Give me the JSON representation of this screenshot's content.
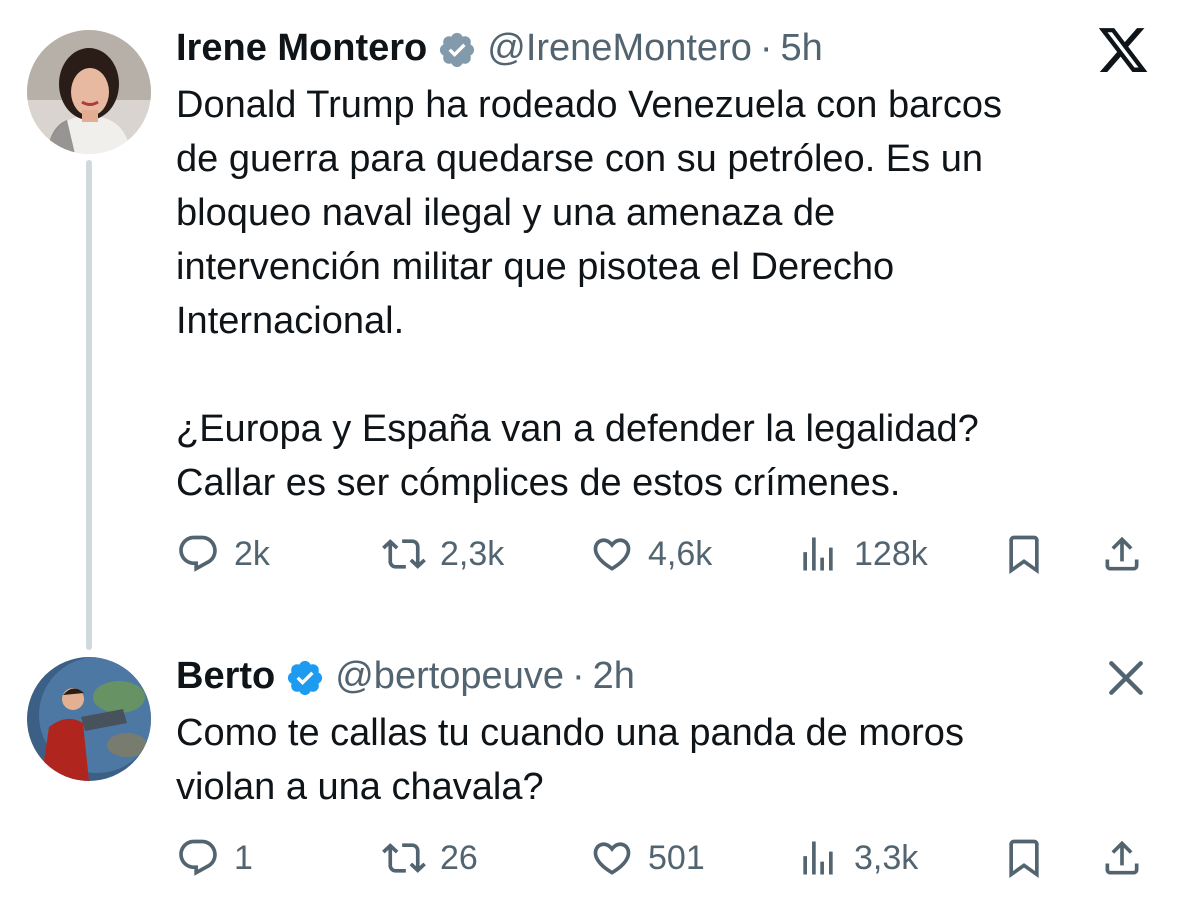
{
  "tweets": [
    {
      "author_name": "Irene Montero",
      "handle": "@IreneMontero",
      "separator": "·",
      "time": "5h",
      "verified": true,
      "text": "Donald Trump ha rodeado Venezuela con barcos\nde guerra para quedarse con su petróleo. Es un\nbloqueo naval ilegal y una amenaza de\nintervención militar que pisotea el Derecho\nInternacional.\n\n¿Europa y España van a defender la legalidad?\nCallar es ser cómplices de estos crímenes.",
      "stats": {
        "replies": "2k",
        "reposts": "2,3k",
        "likes": "4,6k",
        "views": "128k"
      },
      "corner_icon": "x-logo-icon"
    },
    {
      "author_name": "Berto",
      "handle": "@bertopeuve",
      "separator": "·",
      "time": "2h",
      "verified": true,
      "text": "Como te callas tu cuando una panda de moros\nviolan a una chavala?",
      "stats": {
        "replies": "1",
        "reposts": "26",
        "likes": "501",
        "views": "3,3k"
      },
      "corner_icon": "close-icon"
    }
  ],
  "colors": {
    "text_primary": "#0f1419",
    "text_secondary": "#536471",
    "verified_blue": "#1d9bf0",
    "thread_line": "#cfd9de"
  },
  "icons": [
    "reply-icon",
    "repost-icon",
    "like-icon",
    "views-icon",
    "bookmark-icon",
    "share-icon"
  ]
}
